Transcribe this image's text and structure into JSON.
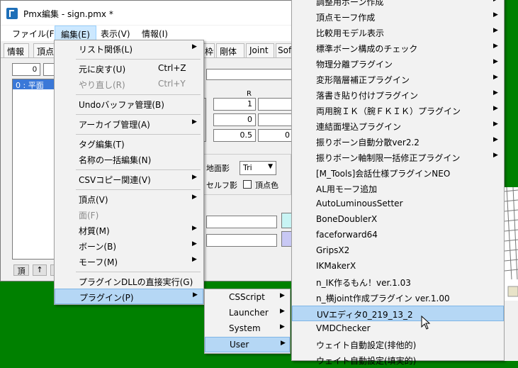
{
  "window": {
    "title": "Pmx編集 - sign.pmx *"
  },
  "menubar": [
    {
      "label": "ファイル(F)"
    },
    {
      "label": "編集(E)"
    },
    {
      "label": "表示(V)"
    },
    {
      "label": "情報(I)"
    }
  ],
  "tabs": [
    "情報",
    "頂点",
    "枠",
    "剛体",
    "Joint",
    "Sof"
  ],
  "left_panel": {
    "index_value": "0",
    "selected_item": "0 : 平面",
    "btn_vertex": "頂",
    "btn_up": "↑"
  },
  "right_panel": {
    "col_r": "R",
    "values": [
      "1",
      "0",
      "0.5",
      "0"
    ],
    "ground_shadow_label": "地面影",
    "select_value": "Tri",
    "self_shadow_label": "セルフ影",
    "vertex_color_label": "頂点色"
  },
  "edit_menu": {
    "items": [
      {
        "label": "リスト関係(L)",
        "submenu": true
      },
      {
        "label": "元に戻す(U)",
        "shortcut": "Ctrl+Z"
      },
      {
        "label": "やり直し(R)",
        "shortcut": "Ctrl+Y",
        "disabled": true
      },
      {
        "label": "Undoバッファ管理(B)"
      },
      {
        "label": "アーカイブ管理(A)",
        "submenu": true
      },
      {
        "label": "タグ編集(T)"
      },
      {
        "label": "名称の一括編集(N)"
      },
      {
        "label": "CSVコピー関連(V)",
        "submenu": true
      },
      {
        "label": "頂点(V)",
        "submenu": true
      },
      {
        "label": "面(F)",
        "disabled": true
      },
      {
        "label": "材質(M)",
        "submenu": true
      },
      {
        "label": "ボーン(B)",
        "submenu": true
      },
      {
        "label": "モーフ(M)",
        "submenu": true
      },
      {
        "label": "プラグインDLLの直接実行(G)"
      },
      {
        "label": "プラグイン(P)",
        "submenu": true,
        "highlighted": true
      }
    ]
  },
  "plugin_menu": {
    "items": [
      {
        "label": "CSScript"
      },
      {
        "label": "Launcher"
      },
      {
        "label": "System"
      },
      {
        "label": "User",
        "highlighted": true
      }
    ]
  },
  "user_menu": {
    "items": [
      {
        "label": "調整用ボーン作成",
        "submenu": true
      },
      {
        "label": "頂点モーフ作成",
        "submenu": true
      },
      {
        "label": "比較用モデル表示",
        "submenu": true
      },
      {
        "label": "標準ボーン構成のチェック",
        "submenu": true
      },
      {
        "label": "物理分離プラグイン",
        "submenu": true
      },
      {
        "label": "変形階層補正プラグイン",
        "submenu": true
      },
      {
        "label": "落書き貼り付けプラグイン",
        "submenu": true
      },
      {
        "label": "両用腕ＩＫ（腕ＦＫＩＫ）プラグイン",
        "submenu": true
      },
      {
        "label": "連結面埋込プラグイン",
        "submenu": true
      },
      {
        "label": "振りボーン自動分散ver2.2",
        "submenu": true
      },
      {
        "label": "振りボーン軸制限一括修正プラグイン",
        "submenu": true
      },
      {
        "label": "[M_Tools]会話仕様プラグインNEO"
      },
      {
        "label": "AL用モーフ追加"
      },
      {
        "label": "AutoLuminousSetter"
      },
      {
        "label": "BoneDoublerX"
      },
      {
        "label": "faceforward64"
      },
      {
        "label": "GripsX2"
      },
      {
        "label": "IKMakerX"
      },
      {
        "label": "n_IK作るもん！ver.1.03"
      },
      {
        "label": "n_横joint作成プラグイン ver.1.00"
      },
      {
        "label": "UVエディタ0_219_13_2",
        "highlighted": true
      },
      {
        "label": "VMDChecker"
      },
      {
        "label": "ウェイト自動設定(排他的)"
      },
      {
        "label": "ウェイト自動設定(填実的)"
      }
    ]
  },
  "colors": {
    "desktop": "#008000",
    "menu_bg": "#f2f2f2",
    "highlight": "#b5d7f5",
    "selection": "#3a78d8"
  },
  "icons": [
    "app-icon",
    "submenu-arrow-icon",
    "mouse-cursor-icon"
  ]
}
